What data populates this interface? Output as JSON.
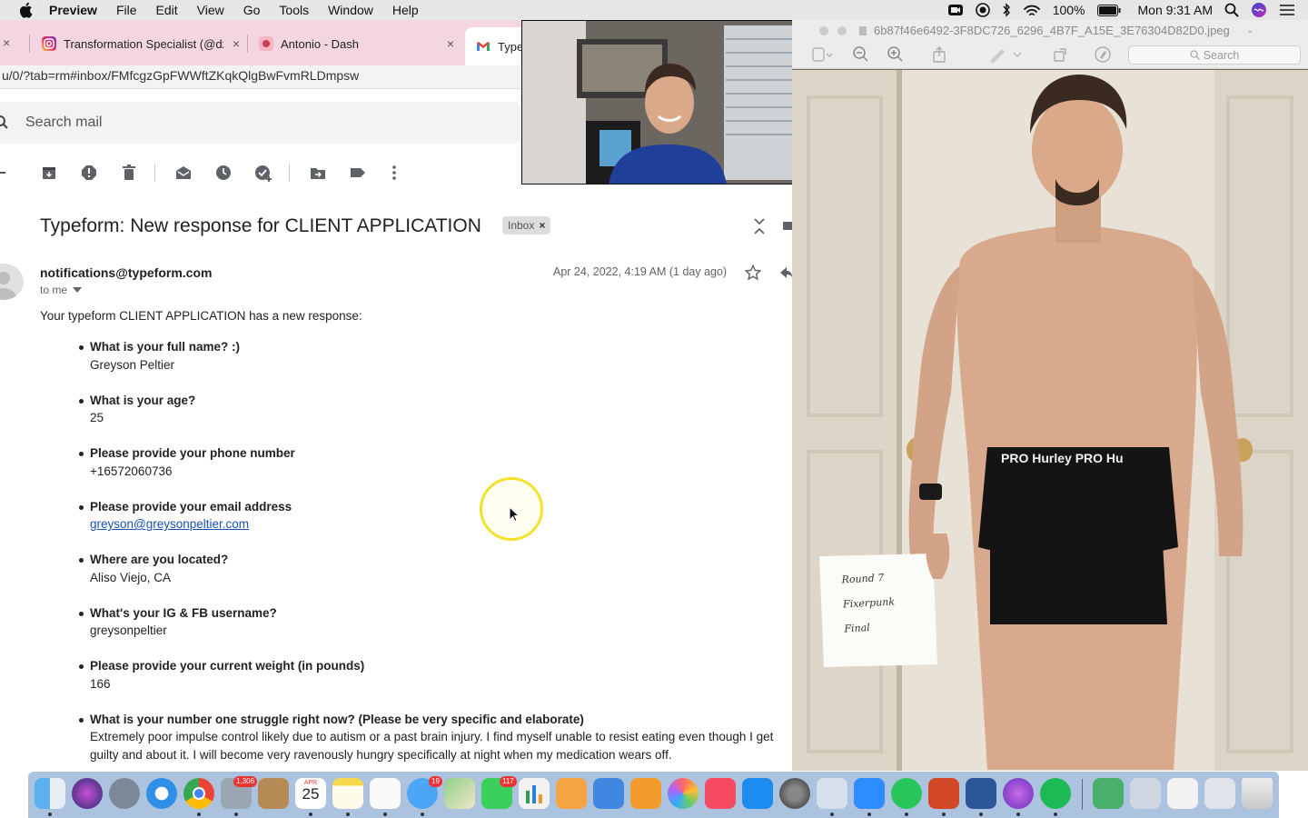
{
  "menubar": {
    "app_name": "Preview",
    "items": [
      "File",
      "Edit",
      "View",
      "Go",
      "Tools",
      "Window",
      "Help"
    ],
    "battery": "100%",
    "clock": "Mon 9:31 AM"
  },
  "browser": {
    "tabs": [
      {
        "label": "Transformation Specialist (@dz",
        "icon": "instagram-icon"
      },
      {
        "label": "Antonio - Dash",
        "icon": "dash-icon"
      },
      {
        "label": "Type",
        "icon": "gmail-icon"
      }
    ],
    "url": "u/0/?tab=rm#inbox/FMfcgzGpFWWftZKqkQlgBwFvmRLDmpsw"
  },
  "gmail": {
    "search_placeholder": "Search mail",
    "subject": "Typeform: New response for CLIENT APPLICATION",
    "label_badge": "Inbox",
    "sender": "notifications@typeform.com",
    "to": "to me",
    "date": "Apr 24, 2022, 4:19 AM (1 day ago)",
    "intro": "Your typeform CLIENT APPLICATION has a new response:",
    "qa": [
      {
        "q": "What is your full name? :)",
        "a": "Greyson Peltier"
      },
      {
        "q": "What is your age?",
        "a": "25"
      },
      {
        "q": "Please provide your phone number",
        "a": "+16572060736"
      },
      {
        "q": "Please provide your email address",
        "a": "greyson@greysonpeltier.com"
      },
      {
        "q": "Where are you located?",
        "a": "Aliso Viejo, CA"
      },
      {
        "q": "What's your IG & FB username?",
        "a": "greysonpeltier"
      },
      {
        "q": "Please provide your current weight (in pounds)",
        "a": "166"
      },
      {
        "q": "What is your number one struggle right now? (Please be very specific and elaborate)",
        "a": "Extremely poor impulse control likely due to autism or a past brain injury. I find myself unable to resist eating even though I get guilty and about it. I will become very ravenously hungry specifically at night when my medication wears off."
      }
    ]
  },
  "preview": {
    "filename": "6b87f46e6492-3F8DC726_6296_4B7F_A15E_3E76304D82D0.jpeg",
    "search_placeholder": "Search",
    "note_lines": [
      "Round 7",
      "Fixerpunk",
      "Final"
    ],
    "shorts_text": "PRO Hurley PRO Hu"
  },
  "dock": {
    "badges": {
      "photos": "1,306",
      "calendar_month": "APR",
      "calendar_day": "25",
      "messages": "19",
      "facetime": "117"
    }
  },
  "colors": {
    "tabbar": "#f4d6e3",
    "link": "#1a53b5",
    "cursor_ring": "#f3e22a",
    "dock": "#8cacd2"
  }
}
